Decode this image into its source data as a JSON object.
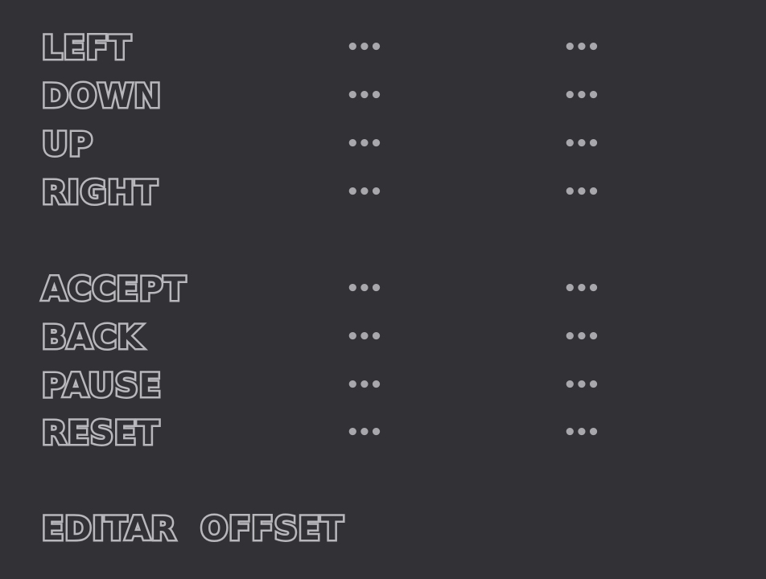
{
  "controls": {
    "rows": [
      {
        "action": "LEFT",
        "primary": "•••",
        "alt": "•••"
      },
      {
        "action": "DOWN",
        "primary": "•••",
        "alt": "•••"
      },
      {
        "action": "UP",
        "primary": "•••",
        "alt": "•••"
      },
      {
        "action": "RIGHT",
        "primary": "•••",
        "alt": "•••"
      },
      {
        "action": "ACCEPT",
        "primary": "•••",
        "alt": "•••"
      },
      {
        "action": "BACK",
        "primary": "•••",
        "alt": "•••"
      },
      {
        "action": "PAUSE",
        "primary": "•••",
        "alt": "•••"
      },
      {
        "action": "RESET",
        "primary": "•••",
        "alt": "•••"
      }
    ],
    "edit_offset_label": "EDITAR  OFFSET"
  },
  "colors": {
    "background": "#323236",
    "outline": "#b8b8bc",
    "placeholder": "#a8a8ac"
  }
}
